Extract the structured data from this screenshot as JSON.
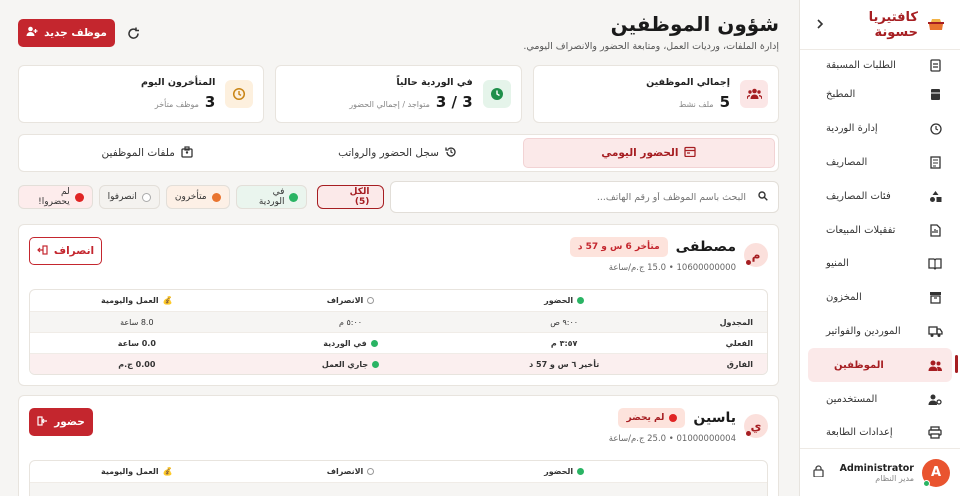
{
  "app": {
    "name": "كافتيريا حسونة",
    "collapse_icon": "chevron-right-icon"
  },
  "sidebar": {
    "items": [
      {
        "label": "الطلبات المسبقة",
        "icon": "clipboard-icon"
      },
      {
        "label": "المطبخ",
        "icon": "kitchen-icon"
      },
      {
        "label": "إدارة الوردية",
        "icon": "shift-icon"
      },
      {
        "label": "المصاريف",
        "icon": "receipt-icon"
      },
      {
        "label": "فئات المصاريف",
        "icon": "shapes-icon"
      },
      {
        "label": "تفقيلات المبيعات",
        "icon": "report-icon"
      },
      {
        "label": "المنيو",
        "icon": "menu-book-icon"
      },
      {
        "label": "المخزون",
        "icon": "archive-icon"
      },
      {
        "label": "الموردين والفواتير",
        "icon": "truck-icon"
      },
      {
        "label": "الموظفين",
        "icon": "users-icon"
      },
      {
        "label": "المستخدمين",
        "icon": "user-gear-icon"
      },
      {
        "label": "إعدادات الطابعة",
        "icon": "printer-icon"
      }
    ],
    "user": {
      "initial": "A",
      "name": "Administrator",
      "role": "مدير النظام"
    }
  },
  "header": {
    "title": "شؤون الموظفين",
    "subtitle": "إدارة الملفات، ورديات العمل، ومتابعة الحضور والانصراف اليومي.",
    "new_button": "موظف جديد"
  },
  "stats": [
    {
      "label": "إجمالي الموظفين",
      "value": "5",
      "note": "ملف نشط"
    },
    {
      "label": "في الوردية حالياً",
      "value": "3 / 3",
      "note": "متواجد / إجمالي الحضور"
    },
    {
      "label": "المتأخرون اليوم",
      "value": "3",
      "note": "موظف متأخر"
    }
  ],
  "tabs": [
    {
      "label": "الحضور اليومي"
    },
    {
      "label": "سجل الحضور والرواتب"
    },
    {
      "label": "ملفات الموظفين"
    }
  ],
  "filters": {
    "search_placeholder": "البحث باسم الموظف أو رقم الهاتف...",
    "chips": [
      {
        "label": "الكل (5)"
      },
      {
        "label": "في الوردية"
      },
      {
        "label": "متأخرون"
      },
      {
        "label": "انصرفوا"
      },
      {
        "label": "لم يحضروا!"
      }
    ]
  },
  "columns": {
    "checkin": "الحضور",
    "checkout": "الانصراف",
    "work": "العمل واليومية"
  },
  "rows": {
    "scheduled": "المجدول",
    "actual": "الفعلي",
    "diff": "الفارق"
  },
  "employees": [
    {
      "initial": "م",
      "name": "مصطفى",
      "badge": "متأخر 6 س و 57 د",
      "phone": "10600000000",
      "rate": "15.0 ج.م/ساعة",
      "action": "انصراف",
      "scheduled": {
        "checkin": "٩:٠٠ ص",
        "checkout": "٥:٠٠ م",
        "work": "8.0 ساعة"
      },
      "actual": {
        "checkin": "٣:٥٧ م",
        "checkout": "في الوردية",
        "work": "0.0 ساعة"
      },
      "diff": {
        "checkin": "تأخير ٦ س و 57 د",
        "checkout": "جاري العمل",
        "work": "0.00 ج.م"
      }
    },
    {
      "initial": "ي",
      "name": "ياسين",
      "badge": "لم يحضر",
      "phone": "01000000004",
      "rate": "25.0 ج.م/ساعة",
      "action": "حضور"
    }
  ],
  "colors": {
    "accent": "#a61e22",
    "button": "#c4262e",
    "green": "#2ab464",
    "orange": "#e9742f",
    "red": "#e02424"
  }
}
